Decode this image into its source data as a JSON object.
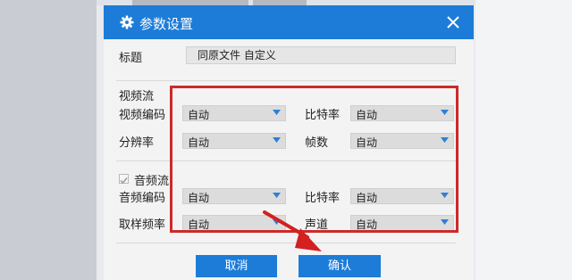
{
  "dialog": {
    "title": "参数设置",
    "title_label": "标题",
    "title_value": "同原文件 自定义",
    "cancel_label": "取消",
    "ok_label": "确认"
  },
  "video": {
    "section_label": "视频流",
    "codec_label": "视频编码",
    "codec_value": "自动",
    "bitrate_label": "比特率",
    "bitrate_value": "自动",
    "resolution_label": "分辨率",
    "resolution_value": "自动",
    "framerate_label": "帧数",
    "framerate_value": "自动"
  },
  "audio": {
    "section_label": "音频流",
    "enabled": true,
    "codec_label": "音频编码",
    "codec_value": "自动",
    "bitrate_label": "比特率",
    "bitrate_value": "自动",
    "samplerate_label": "取样频率",
    "samplerate_value": "自动",
    "channels_label": "声道",
    "channels_value": "自动"
  },
  "colors": {
    "accent": "#1c7cd8",
    "highlight": "#cc2a2a"
  },
  "icons": {
    "title": "gear-icon",
    "close": "close-icon",
    "dropdown": "dropdown-arrow-icon",
    "annotation": "red-arrow-icon"
  }
}
